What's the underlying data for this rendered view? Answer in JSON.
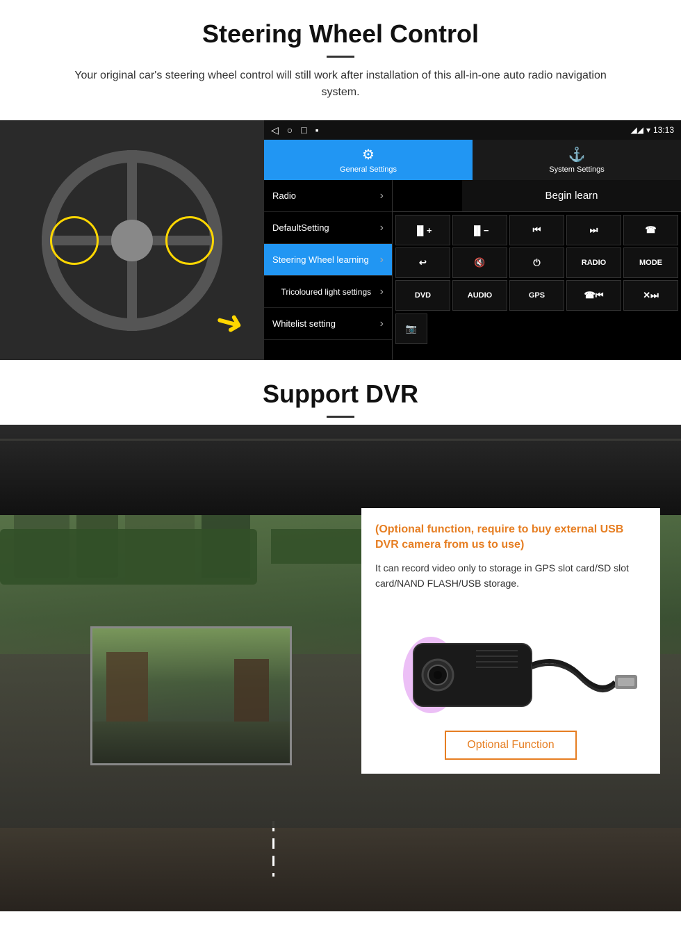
{
  "section1": {
    "title": "Steering Wheel Control",
    "subtitle": "Your original car's steering wheel control will still work after installation of this all-in-one auto radio navigation system.",
    "statusbar": {
      "time": "13:13",
      "signal": "▼",
      "wifi": "▾"
    },
    "tabs": [
      {
        "id": "general",
        "label": "General Settings",
        "icon": "⚙",
        "active": true
      },
      {
        "id": "system",
        "label": "System Settings",
        "icon": "☰",
        "active": false
      }
    ],
    "menu_items": [
      {
        "label": "Radio",
        "active": false
      },
      {
        "label": "DefaultSetting",
        "active": false
      },
      {
        "label": "Steering Wheel learning",
        "active": true
      },
      {
        "label": "Tricoloured light settings",
        "active": false
      },
      {
        "label": "Whitelist setting",
        "active": false
      }
    ],
    "begin_learn_label": "Begin learn",
    "control_buttons": [
      {
        "label": "▌▌+",
        "row": 1
      },
      {
        "label": "▌▌−",
        "row": 1
      },
      {
        "label": "⏮",
        "row": 1
      },
      {
        "label": "⏭",
        "row": 1
      },
      {
        "label": "☎",
        "row": 1
      },
      {
        "label": "↩",
        "row": 2
      },
      {
        "label": "▌✕",
        "row": 2
      },
      {
        "label": "⏻",
        "row": 2
      },
      {
        "label": "RADIO",
        "row": 2
      },
      {
        "label": "MODE",
        "row": 2
      },
      {
        "label": "DVD",
        "row": 3
      },
      {
        "label": "AUDIO",
        "row": 3
      },
      {
        "label": "GPS",
        "row": 3
      },
      {
        "label": "☎⏮",
        "row": 3
      },
      {
        "label": "✕⏭",
        "row": 3
      }
    ],
    "extra_btn": "📷"
  },
  "section2": {
    "title": "Support DVR",
    "optional_text": "(Optional function, require to buy external USB DVR camera from us to use)",
    "description": "It can record video only to storage in GPS slot card/SD slot card/NAND FLASH/USB storage.",
    "optional_function_label": "Optional Function"
  }
}
